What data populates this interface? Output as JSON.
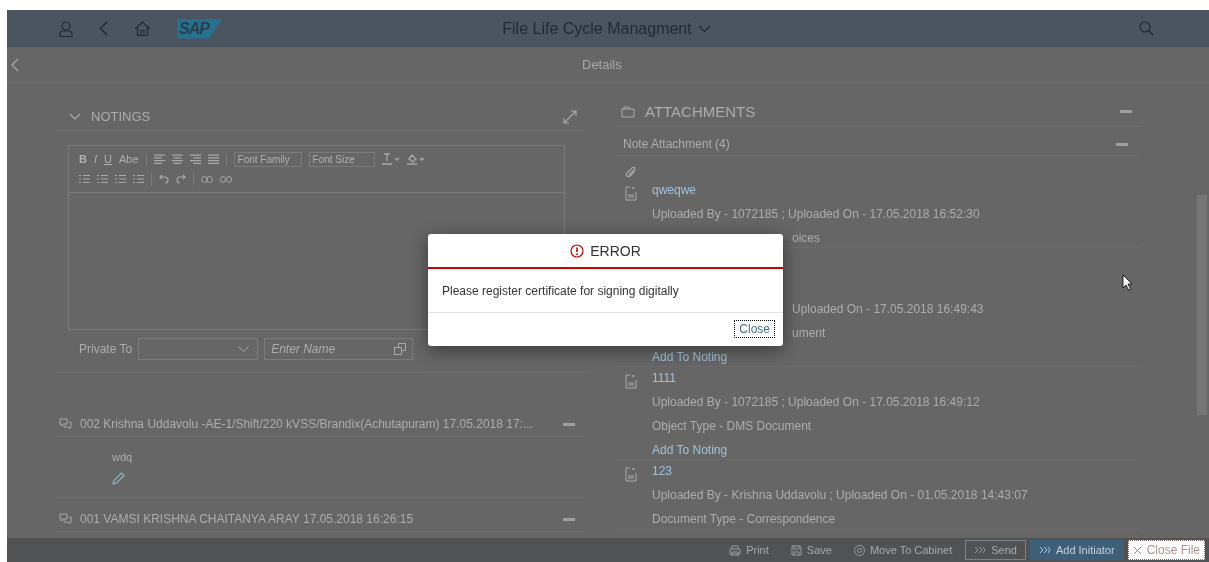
{
  "header": {
    "logo": "SAP",
    "title": "File Life Cycle Managment"
  },
  "subheader": {
    "title": "Details"
  },
  "notings": {
    "title": "NOTINGS",
    "format_buttons": [
      "B",
      "I",
      "U",
      "Abe"
    ],
    "font_family": "Font Family",
    "font_size": "Font Size",
    "private_to_label": "Private To",
    "name_placeholder": "Enter Name"
  },
  "notes": [
    {
      "title": "002 Krishna Uddavolu -AE-1/Shift/220 kVSS/Brandix(Achutapuram) 17.05.2018 17:...",
      "body": "wdq"
    },
    {
      "title": "001 VAMSI KRISHNA CHAITANYA ARAY 17.05.2018 16:26:15"
    }
  ],
  "attachments": {
    "title": "ATTACHMENTS",
    "group": "Note Attachment (4)",
    "items": [
      {
        "lines": [
          {
            "kind": "name",
            "text": "qweqwe"
          },
          {
            "kind": "meta",
            "text": "Uploaded By - 1072185 ; Uploaded On - 17.05.2018 16:52:30"
          },
          {
            "kind": "fragment",
            "text": "oices"
          }
        ]
      },
      {
        "lines": [
          {
            "kind": "fragment",
            "text": "Uploaded On - 17.05.2018 16:49:43"
          },
          {
            "kind": "fragment",
            "text": "ument"
          },
          {
            "kind": "link",
            "text": "Add To Noting"
          }
        ]
      },
      {
        "lines": [
          {
            "kind": "name",
            "text": "1111"
          },
          {
            "kind": "meta",
            "text": "Uploaded By - 1072185 ; Uploaded On - 17.05.2018 16:49:12"
          },
          {
            "kind": "meta",
            "text": "Object Type - DMS Document"
          },
          {
            "kind": "link",
            "text": "Add To Noting"
          }
        ]
      },
      {
        "lines": [
          {
            "kind": "name",
            "text": "123"
          },
          {
            "kind": "meta",
            "text": "Uploaded By - Krishna Uddavolu ; Uploaded On - 01.05.2018 14:43:07"
          },
          {
            "kind": "meta",
            "text": "Document Type - Correspondence"
          }
        ]
      }
    ]
  },
  "footer": {
    "buttons": [
      {
        "label": "Print",
        "kind": "print"
      },
      {
        "label": "Save",
        "kind": "save"
      },
      {
        "label": "Move To Cabinet",
        "kind": "cabinet"
      },
      {
        "label": "Send",
        "kind": "send"
      },
      {
        "label": "Add Initiator",
        "kind": "primary"
      },
      {
        "label": "Close File",
        "kind": "close"
      }
    ]
  },
  "dialog": {
    "title": "ERROR",
    "message": "Please register certificate for signing digitally",
    "button": "Close"
  }
}
